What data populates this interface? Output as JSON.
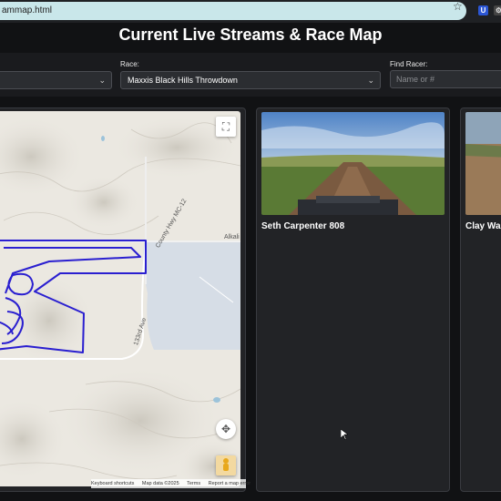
{
  "browser": {
    "url": "ammap.html",
    "star_icon": "star-icon",
    "extensions": [
      "U",
      "⚙"
    ]
  },
  "page": {
    "title": "Current Live Streams & Race Map"
  },
  "filters": {
    "race_label": "Race:",
    "race_value": "Maxxis Black Hills Throwdown",
    "find_label": "Find Racer:",
    "find_placeholder": "Name or #"
  },
  "map": {
    "road_labels": [
      "County Hwy MC-12",
      "133rd Ave",
      "Alkali"
    ],
    "attribution": [
      "Keyboard shortcuts",
      "Map data ©2025",
      "Terms",
      "Report a map error"
    ],
    "route_color": "#2a1fd0"
  },
  "streams": [
    {
      "name": "Seth Carpenter 808"
    },
    {
      "name": "Clay Walk"
    }
  ]
}
